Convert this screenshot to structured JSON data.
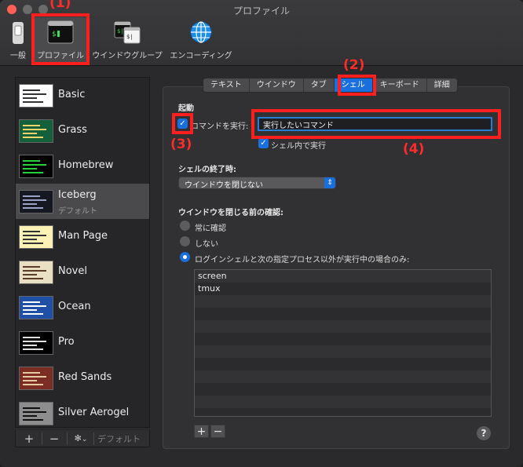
{
  "window": {
    "title": "プロファイル"
  },
  "toolbar": {
    "general": "一般",
    "profiles": "プロファイル",
    "window_groups": "ウインドウグループ",
    "encoding": "エンコーディング"
  },
  "annotations": {
    "a1": "(1)",
    "a2": "(2)",
    "a3": "(3)",
    "a4": "(4)"
  },
  "profiles": [
    {
      "name": "Basic",
      "bg": "#ffffff",
      "fg": "#333333"
    },
    {
      "name": "Grass",
      "bg": "#14603a",
      "fg": "#f2d36a"
    },
    {
      "name": "Homebrew",
      "bg": "#000000",
      "fg": "#27d13a"
    },
    {
      "name": "Iceberg",
      "sub": "デフォルト",
      "bg": "#161821",
      "fg": "#9aa1c4"
    },
    {
      "name": "Man Page",
      "bg": "#fdf2b5",
      "fg": "#333333"
    },
    {
      "name": "Novel",
      "bg": "#e9dfc3",
      "fg": "#5a3a28"
    },
    {
      "name": "Ocean",
      "bg": "#1f4fa6",
      "fg": "#ffffff"
    },
    {
      "name": "Pro",
      "bg": "#000000",
      "fg": "#e0e0e0"
    },
    {
      "name": "Red Sands",
      "bg": "#7b2d24",
      "fg": "#e6c9a0"
    },
    {
      "name": "Silver Aerogel",
      "bg": "#8d8d8d",
      "fg": "#111111"
    }
  ],
  "list_footer": {
    "add": "+",
    "remove": "−",
    "gear": "✻",
    "chevron": "⌄",
    "default": "デフォルト"
  },
  "tabs": [
    {
      "label": "テキスト"
    },
    {
      "label": "ウインドウ"
    },
    {
      "label": "タブ"
    },
    {
      "label": "シェル",
      "active": true
    },
    {
      "label": "キーボード"
    },
    {
      "label": "詳細"
    }
  ],
  "shell": {
    "startup_heading": "起動",
    "run_command_label": "コマンドを実行:",
    "run_command_checked": true,
    "command_value": "実行したいコマンド",
    "run_inside_shell_label": "シェル内で実行",
    "run_inside_shell_checked": true,
    "on_exit_heading": "シェルの終了時:",
    "on_exit_value": "ウインドウを閉じない",
    "confirm_heading": "ウインドウを閉じる前の確認:",
    "radio_always": "常に確認",
    "radio_never": "しない",
    "radio_only_if": "ログインシェルと次の指定プロセス以外が実行中の場合のみ:",
    "processes": [
      "screen",
      "tmux"
    ],
    "add": "+",
    "remove": "−",
    "help": "?"
  },
  "colors": {
    "accent": "#1a6fdf",
    "annotation": "#ff1f1f"
  }
}
